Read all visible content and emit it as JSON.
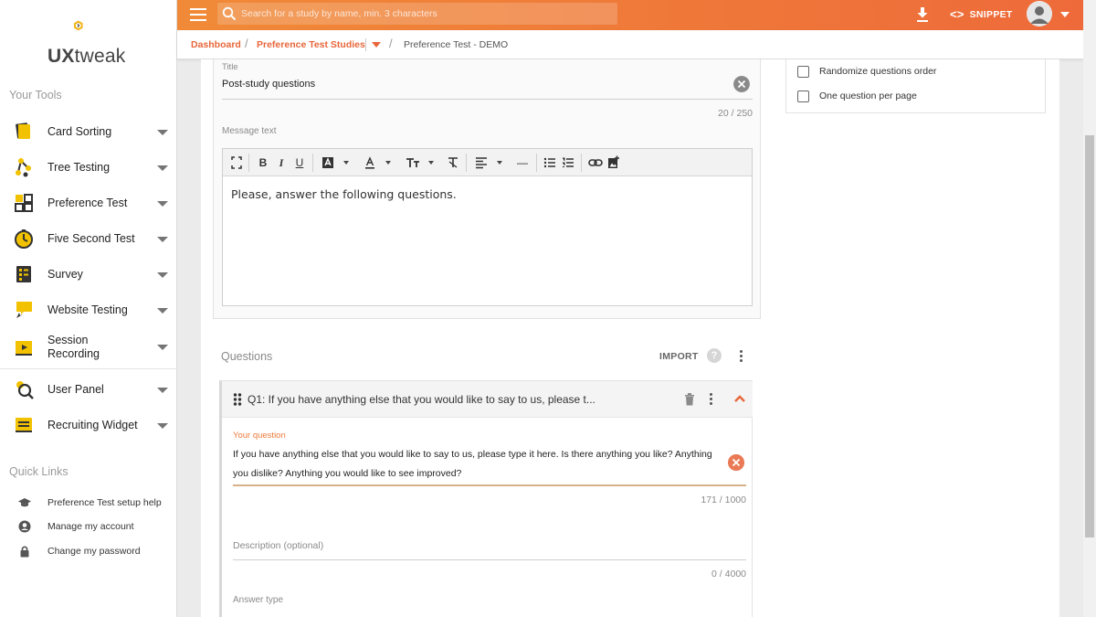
{
  "brand": {
    "logo_text_bold": "UX",
    "logo_text_thin": "tweak"
  },
  "colors": {
    "accent": "#ee6f3a",
    "gradient_start": "#f08a38",
    "gradient_end": "#ee6a3a",
    "tool_icon": "#f2c200"
  },
  "sidebar": {
    "your_tools_title": "Your Tools",
    "tools": [
      {
        "label": "Card Sorting",
        "icon": "card-sorting-icon"
      },
      {
        "label": "Tree Testing",
        "icon": "tree-testing-icon"
      },
      {
        "label": "Preference Test",
        "icon": "preference-test-icon"
      },
      {
        "label": "Five Second Test",
        "icon": "stopwatch-icon"
      },
      {
        "label": "Survey",
        "icon": "survey-icon"
      },
      {
        "label": "Website Testing",
        "icon": "website-testing-icon"
      },
      {
        "label": "Session\nRecording",
        "icon": "session-recording-icon"
      },
      {
        "label": "User Panel",
        "icon": "user-panel-icon"
      },
      {
        "label": "Recruiting Widget",
        "icon": "recruiting-widget-icon"
      }
    ],
    "quick_links_title": "Quick Links",
    "quick_links": [
      {
        "label": "Preference Test setup help",
        "icon": "graduation-cap-icon"
      },
      {
        "label": "Manage my account",
        "icon": "account-circle-icon"
      },
      {
        "label": "Change my password",
        "icon": "lock-icon"
      }
    ]
  },
  "topbar": {
    "search_placeholder": "Search for a study by name, min. 3 characters",
    "snippet_label": "SNIPPET"
  },
  "breadcrumb": {
    "items": [
      "Dashboard",
      "Preference Test Studies"
    ],
    "current": "Preference Test - DEMO"
  },
  "message_section": {
    "title_label": "Title",
    "title_value": "Post-study questions",
    "title_counter": "20 / 250",
    "message_label": "Message text",
    "message_body": "Please, answer the following questions."
  },
  "settings": {
    "options": [
      {
        "label": "Randomize questions order",
        "checked": false
      },
      {
        "label": "One question per page",
        "checked": false
      }
    ]
  },
  "questions": {
    "heading": "Questions",
    "import_label": "IMPORT",
    "help_symbol": "?",
    "items": [
      {
        "header": "Q1: If you have anything else that you would like to say to us, please t...",
        "question_label": "Your question",
        "question_text": "If you have anything else that you would like to say to us, please type it here. Is there anything you like? Anything you dislike? Anything you would like to see improved?",
        "question_counter": "171 / 1000",
        "description_placeholder": "Description (optional)",
        "description_counter": "0 / 4000",
        "answer_type_label": "Answer type"
      }
    ]
  }
}
